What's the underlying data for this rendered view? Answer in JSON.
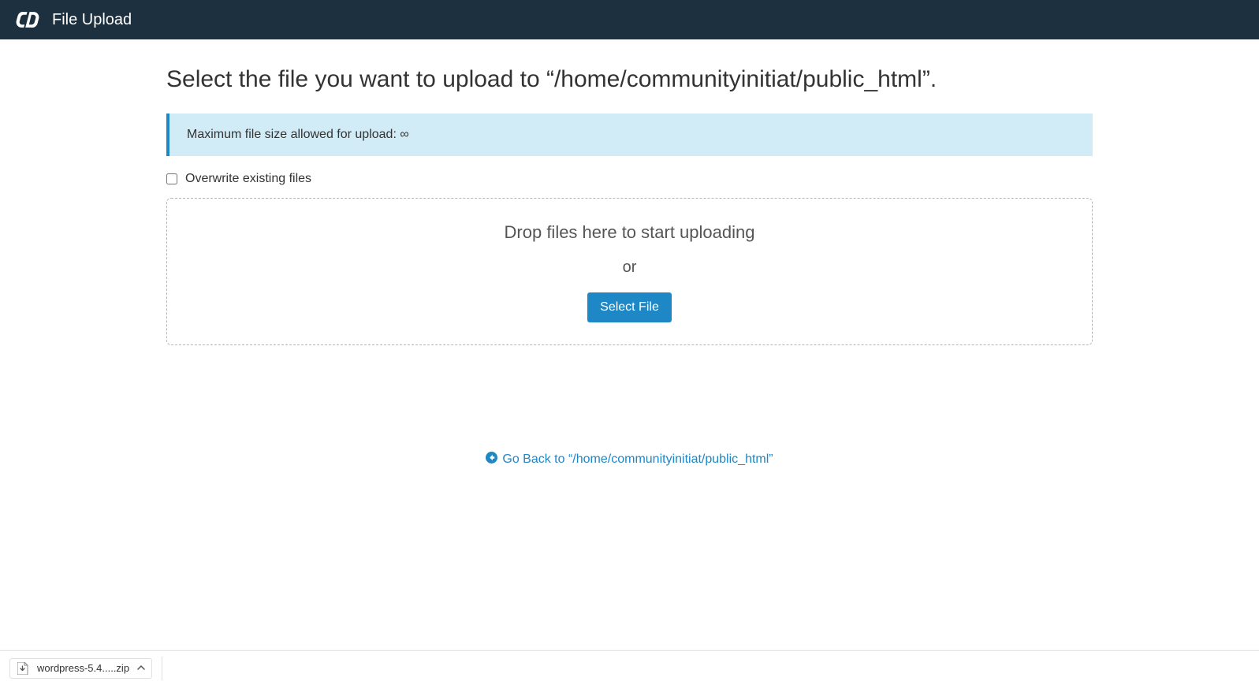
{
  "navbar": {
    "title": "File Upload"
  },
  "page": {
    "heading_prefix": "Select the file you want to upload to ",
    "heading_path": "“/home/communityinitiat/public_html”.",
    "info_text": "Maximum file size allowed for upload: ∞",
    "overwrite_label": "Overwrite existing files",
    "drop_text": "Drop files here to start uploading",
    "or_text": "or",
    "select_file_label": "Select File"
  },
  "goback": {
    "prefix": "Go Back to ",
    "path": "“/home/communityinitiat/public_html”"
  },
  "download": {
    "file_name": "wordpress-5.4.....zip"
  }
}
